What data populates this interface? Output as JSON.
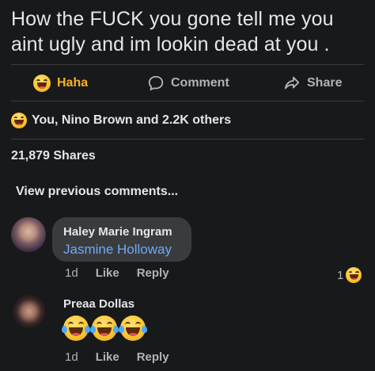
{
  "post": {
    "text": "How the FUCK you gone tell me you aint ugly and im lookin dead at you ."
  },
  "actions": {
    "haha_label": "Haha",
    "comment_label": "Comment",
    "share_label": "Share",
    "haha_color": "#f7b125"
  },
  "reactions": {
    "summary": "You, Nino Brown and 2.2K others"
  },
  "shares": {
    "label": "21,879 Shares"
  },
  "comments": {
    "view_previous": "View previous comments...",
    "items": [
      {
        "author": "Haley Marie Ingram",
        "mention": "Jasmine Holloway",
        "time": "1d",
        "like_label": "Like",
        "reply_label": "Reply",
        "reaction_count": "1"
      },
      {
        "author": "Preaa Dollas",
        "content_emojis": [
          "tears-of-joy-icon",
          "tears-of-joy-icon",
          "tears-of-joy-icon"
        ],
        "time": "1d",
        "like_label": "Like",
        "reply_label": "Reply"
      }
    ]
  },
  "colors": {
    "background": "#18191a",
    "bubble": "#3a3b3c",
    "mention": "#6ea8fe",
    "secondary_text": "#b0b3b8",
    "primary_text": "#e4e6eb"
  }
}
